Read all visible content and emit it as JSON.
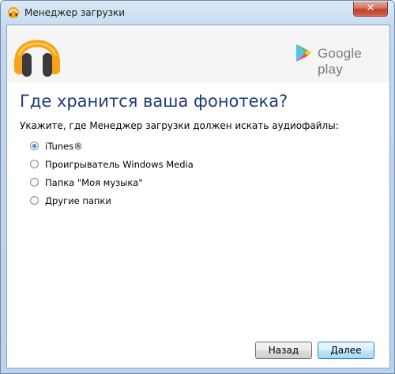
{
  "window": {
    "title": "Менеджер загрузки",
    "close_label": "✕"
  },
  "banner": {
    "brand_text": "Google play"
  },
  "main": {
    "heading": "Где хранится ваша фонотека?",
    "instructions": "Укажите, где Менеджер загрузки должен искать аудиофайлы:",
    "options": [
      {
        "label": "iTunes®",
        "checked": true
      },
      {
        "label": "Проигрыватель Windows Media",
        "checked": false
      },
      {
        "label": "Папка \"Моя музыка\"",
        "checked": false
      },
      {
        "label": "Другие папки",
        "checked": false
      }
    ]
  },
  "footer": {
    "back_label": "Назад",
    "next_label": "Далее"
  },
  "colors": {
    "heading": "#1f3b7a",
    "headphones_orange": "#f6a21b",
    "radio_checked": "#1b59a8"
  }
}
